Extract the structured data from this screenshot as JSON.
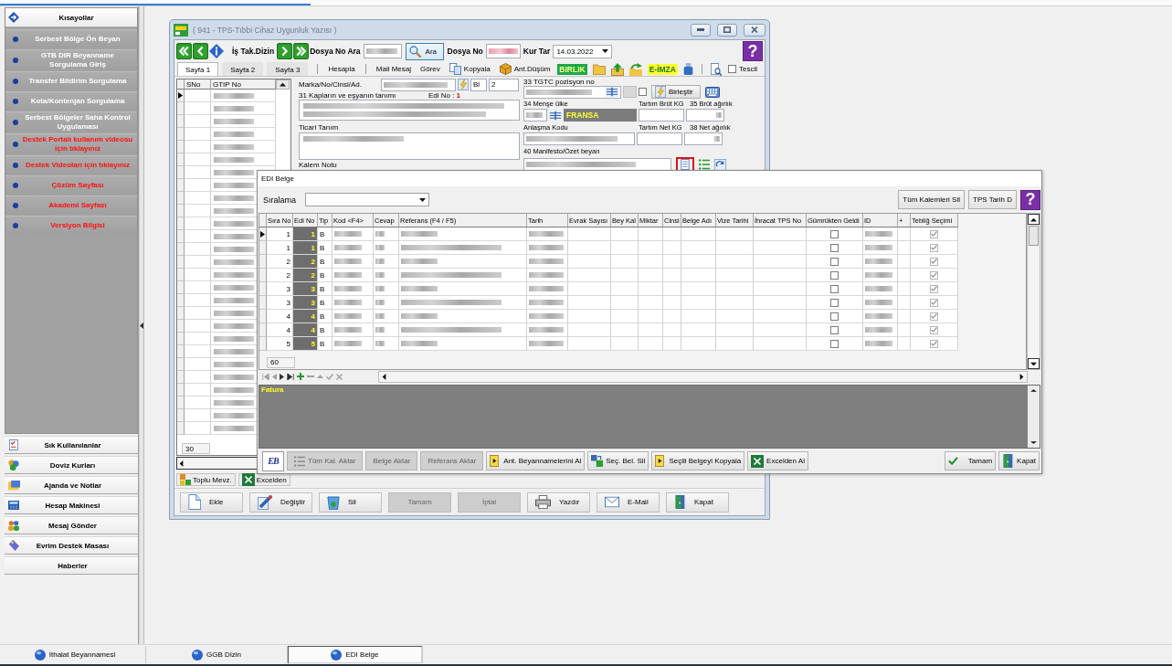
{
  "sidebar": {
    "title": "Kısayollar",
    "links": [
      {
        "label": "Serbest Bölge Ön Beyan",
        "kind": "normal"
      },
      {
        "label": "GTB DIR Beyanname Sorgulama Giriş",
        "kind": "normal"
      },
      {
        "label": "Transfer Bildirim Sorgulama",
        "kind": "normal"
      },
      {
        "label": "Kota/Kontenjan Sorgulama",
        "kind": "normal"
      },
      {
        "label": "Serbest Bölgeler Saha Kontrol Uygulaması",
        "kind": "normal"
      },
      {
        "label": "Destek Portalı kullanım videosu için tıklayınız",
        "kind": "alert"
      },
      {
        "label": "Destek Videoları için tıklayınız",
        "kind": "alert"
      },
      {
        "label": "Çözüm Sayfası",
        "kind": "alert"
      },
      {
        "label": "Akademi Sayfası",
        "kind": "alert"
      },
      {
        "label": "Versiyon Bilgisi",
        "kind": "alert"
      }
    ],
    "tools": [
      "Sık Kullanılanlar",
      "Doviz Kurları",
      "Ajanda ve Notlar",
      "Hesap Makinesi",
      "Mesaj Gönder",
      "Evrim Destek Masası",
      "Haberler"
    ]
  },
  "main_window": {
    "title": "( 941 - TPS-Tıbbi Cihaz Uygunluk Yazısı )",
    "toolbar": {
      "work_list": "İş Tak.Dizin",
      "search_label": "Dosya No Ara",
      "search_button": "Ara",
      "file_label": "Dosya No",
      "rate_label": "Kur Tar",
      "rate_date": "14.03.2022",
      "help": "?"
    },
    "tabs": [
      {
        "label": "Sayfa 1",
        "selected": true
      },
      {
        "label": "Sayfa 2",
        "selected": false
      },
      {
        "label": "Sayfa 3",
        "selected": false
      }
    ],
    "actions": [
      "Hesapla",
      "Mail Mesaj",
      "Görev",
      "Kopyala",
      "Ant.Düşüm"
    ],
    "union_badge": "BIRLIK",
    "signature_badge": "E-İMZA",
    "register": {
      "label": "Tescil",
      "checked": false
    },
    "item_grid": {
      "columns": [
        "SNo",
        "GTIP No"
      ],
      "rows": [
        {
          "selected": true
        },
        {
          "selected": false
        },
        {
          "selected": false
        },
        {
          "selected": false
        },
        {
          "selected": false
        },
        {
          "selected": false
        },
        {
          "selected": false
        },
        {
          "selected": false
        },
        {
          "selected": false
        },
        {
          "selected": false
        },
        {
          "selected": false
        },
        {
          "selected": false
        },
        {
          "selected": false
        },
        {
          "selected": false
        },
        {
          "selected": false
        },
        {
          "selected": false
        },
        {
          "selected": false
        },
        {
          "selected": false
        },
        {
          "selected": false
        },
        {
          "selected": false
        },
        {
          "selected": false
        },
        {
          "selected": false
        },
        {
          "selected": false
        },
        {
          "selected": false
        },
        {
          "selected": false
        },
        {
          "selected": false
        },
        {
          "selected": false
        }
      ],
      "count": "30"
    },
    "form": {
      "brand_label": "Marka/No/Cinsi/Ad.",
      "package_type": "Bl",
      "package_count": "2",
      "description_label": "31 Kapların ve eşyanın tanımı",
      "edi_label": "Edi No :",
      "edi_value": "1",
      "trade_label": "Ticari Tanım",
      "note_label": "Kalem Notu",
      "tariff_label": "33 TGTC pozisyon no",
      "merge_checked": false,
      "merge_button": "Birleştir",
      "origin_label": "34 Menşe ülke",
      "origin_country": "FRANSA",
      "gross_tare_label": "Tartım Brüt KG",
      "gross_label": "35 Brüt ağırlık",
      "agreement_label": "Anlaşma Kodu",
      "net_tare_label": "Tartım Net KG",
      "net_label": "38 Net ağırlık",
      "manifest_label": "40 Manifesto/Özet beyan"
    },
    "lower_tabs": [
      "Toplu Mevz.",
      "Excelden"
    ],
    "buttons": [
      {
        "label": "Ekle",
        "disabled": false
      },
      {
        "label": "Değiştir",
        "disabled": false
      },
      {
        "label": "Sil",
        "disabled": false
      },
      {
        "label": "Tamam",
        "disabled": true
      },
      {
        "label": "İptal",
        "disabled": true
      },
      {
        "label": "Yazdır",
        "disabled": false
      },
      {
        "label": "E-Mail",
        "disabled": false
      },
      {
        "label": "Kapat",
        "disabled": false
      }
    ]
  },
  "edi_dialog": {
    "title": "EDI Belge",
    "sort_label": "Sıralama",
    "delete_all": "Tüm Kalemleri Sil",
    "tps_date": "TPS Tarih D",
    "help": "?",
    "columns": [
      "Sıra No",
      "Edi No",
      "Tip",
      "Kod <F4>",
      "Cevap",
      "Referans (F4 / F5)",
      "Tarih",
      "Evrak Sayısı",
      "Bey Kal",
      "Miktar",
      "Cinsi",
      "Belge Adı",
      "Vize Tarihi",
      "İhracat TPS No",
      "Gümrükten Geldi",
      "ID",
      "+",
      "Tebliğ Seçimi"
    ],
    "rows": [
      {
        "sira_no": "1",
        "edi_no": "1",
        "tip": "B",
        "from_customs": false,
        "notice": true,
        "selected": true
      },
      {
        "sira_no": "1",
        "edi_no": "1",
        "tip": "B",
        "from_customs": false,
        "notice": true,
        "selected": false
      },
      {
        "sira_no": "2",
        "edi_no": "2",
        "tip": "B",
        "from_customs": false,
        "notice": true,
        "selected": false
      },
      {
        "sira_no": "2",
        "edi_no": "2",
        "tip": "B",
        "from_customs": false,
        "notice": true,
        "selected": false
      },
      {
        "sira_no": "3",
        "edi_no": "3",
        "tip": "B",
        "from_customs": false,
        "notice": true,
        "selected": false
      },
      {
        "sira_no": "3",
        "edi_no": "3",
        "tip": "B",
        "from_customs": false,
        "notice": true,
        "selected": false
      },
      {
        "sira_no": "4",
        "edi_no": "4",
        "tip": "B",
        "from_customs": false,
        "notice": true,
        "selected": false
      },
      {
        "sira_no": "4",
        "edi_no": "4",
        "tip": "B",
        "from_customs": false,
        "notice": true,
        "selected": false
      },
      {
        "sira_no": "5",
        "edi_no": "5",
        "tip": "B",
        "from_customs": false,
        "notice": true,
        "selected": false
      }
    ],
    "record_count": "60",
    "note_title": "Fatura",
    "logo": "EB",
    "tool_buttons": [
      {
        "label": "Tüm Kal. Aktar",
        "disabled": true
      },
      {
        "label": "Belge Aktar",
        "disabled": true
      },
      {
        "label": "Referans Aktar",
        "disabled": true
      },
      {
        "label": "Ant. Beyannamelerini Al",
        "disabled": false
      },
      {
        "label": "Seç. Bel. Sil",
        "disabled": false
      },
      {
        "label": "Seçili Belgeyi Kopyala",
        "disabled": false
      },
      {
        "label": "Excelden Al",
        "disabled": false
      }
    ],
    "confirm": "Tamam",
    "close": "Kapat"
  },
  "taskbar": [
    {
      "label": "İthalat Beyannamesi",
      "selected": false
    },
    {
      "label": "GGB Dizin",
      "selected": false
    },
    {
      "label": "EDI Belge",
      "selected": true
    }
  ]
}
